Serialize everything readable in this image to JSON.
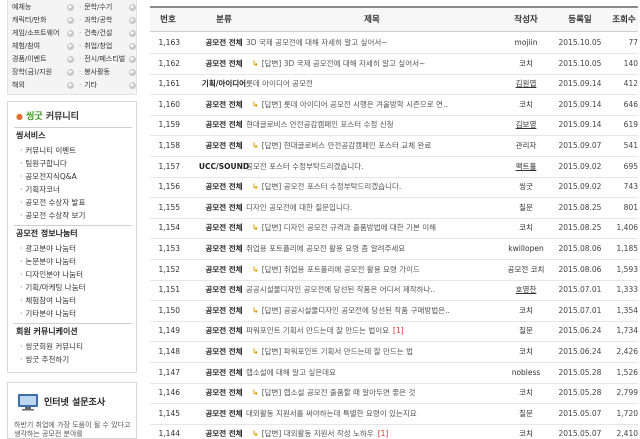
{
  "sidebar": {
    "categories": [
      {
        "left": "예체능",
        "right": "문학/수기"
      },
      {
        "left": "캐릭터/만화",
        "right": "과학/공학"
      },
      {
        "left": "게임/소프트웨어",
        "right": "건축/건설"
      },
      {
        "left": "체험/참여",
        "right": "취업/창업"
      },
      {
        "left": "경품/이벤트",
        "right": "전시/페스티벌"
      },
      {
        "left": "장학(금)/지원",
        "right": "봉사활동"
      },
      {
        "left": "해외",
        "right": "기타"
      }
    ],
    "community": {
      "brand": "씽굿",
      "title": "커뮤니티",
      "sections": [
        {
          "title": "씽서비스",
          "items": [
            "커뮤니티 이벤트",
            "팀원구합니다",
            "공모전지식Q&A",
            "기획자코너",
            "공모전 수상자 발표",
            "공모전 수상작 보기"
          ]
        },
        {
          "title": "공모전 정보나눔터",
          "items": [
            "광고분야 나눔터",
            "논문분야 나눔터",
            "디자인분야 나눔터",
            "기획/마케팅 나눔터",
            "체험참여 나눔터",
            "기타분야 나눔터"
          ]
        },
        {
          "title": "회원 커뮤니케이션",
          "items": [
            "씽굿회원 커뮤니티",
            "씽굿 추천하기"
          ]
        }
      ]
    },
    "survey": {
      "title": "인터넷 설문조사",
      "question": "하반기 취업에 가장 도움이 될 수 있다고 생각하는 공모전 분야를"
    }
  },
  "board": {
    "headers": {
      "num": "번호",
      "category": "분류",
      "title": "제목",
      "author": "작성자",
      "date": "등록일",
      "views": "조회수"
    },
    "reply_tag": "[답변]",
    "rows": [
      {
        "num": "1,163",
        "category": "공모전 전체",
        "reply": false,
        "title": "3D 국제 공모전에 대해 자세히 알고 싶어서~",
        "author": "mojiin",
        "date": "2015.10.05",
        "views": "77"
      },
      {
        "num": "1,162",
        "category": "공모전 전체",
        "reply": true,
        "title": "3D 국제 공모전에 대해 자세히 알고 싶어서~",
        "author": "코치",
        "date": "2015.10.05",
        "views": "140"
      },
      {
        "num": "1,161",
        "category": "기획/아이디어",
        "reply": false,
        "title": "롯데 아이디어 공모전",
        "author": "김원엽",
        "date": "2015.09.14",
        "views": "412",
        "author_link": true
      },
      {
        "num": "1,160",
        "category": "공모전 전체",
        "reply": true,
        "title": "롯데 아이디어 공모전 시행은 겨울방학 시즌으로 연..",
        "author": "코치",
        "date": "2015.09.14",
        "views": "646"
      },
      {
        "num": "1,159",
        "category": "공모전 전체",
        "reply": false,
        "title": "현대글로비스 안전공감캠페인 포스터 수정 신청",
        "author": "김보영",
        "date": "2015.09.14",
        "views": "619",
        "author_link": true
      },
      {
        "num": "1,158",
        "category": "공모전 전체",
        "reply": true,
        "title": "현대글로비스 안전공감캠페인 포스터 교체 완료",
        "author": "관리자",
        "date": "2015.09.07",
        "views": "541"
      },
      {
        "num": "1,157",
        "category": "UCC/SOUND",
        "reply": false,
        "title": "공모전 포스터 수정부탁드리겠습니다.",
        "author": "팩트홀",
        "date": "2015.09.02",
        "views": "695",
        "author_link": true
      },
      {
        "num": "1,156",
        "category": "공모전 전체",
        "reply": true,
        "title": "공모전 포스터 수정부탁드리겠습니다.",
        "author": "씽굿",
        "date": "2015.09.02",
        "views": "743"
      },
      {
        "num": "1,155",
        "category": "공모전 전체",
        "reply": false,
        "title": "디자인 공모전에 대한 질문입니다.",
        "author": "질문",
        "date": "2015.08.25",
        "views": "801"
      },
      {
        "num": "1,154",
        "category": "공모전 전체",
        "reply": true,
        "title": "디자인 공모전 규격과 출품방법에 대한 기본 이해",
        "author": "코치",
        "date": "2015.08.25",
        "views": "1,406"
      },
      {
        "num": "1,153",
        "category": "공모전 전체",
        "reply": false,
        "title": "취업용 포트폴리에 공모전 활용 요령 좀 알려주세요",
        "author": "kwillopen",
        "date": "2015.08.06",
        "views": "1,185"
      },
      {
        "num": "1,152",
        "category": "공모전 전체",
        "reply": true,
        "title": "취업용 포트폴리에 공모전 활용 요령 가이드",
        "author": "공모전 코치",
        "date": "2015.08.06",
        "views": "1,593"
      },
      {
        "num": "1,151",
        "category": "공모전 전체",
        "reply": false,
        "title": "공공시설물디자인 공모전에 당선된 작품은 어디서 제작하나..",
        "author": "호영찬",
        "date": "2015.07.01",
        "views": "1,333",
        "author_link": true
      },
      {
        "num": "1,150",
        "category": "공모전 전체",
        "reply": true,
        "title": "공공시설물디자인 공모전에 당선된 작품 구매방법은..",
        "author": "코치",
        "date": "2015.07.01",
        "views": "1,354"
      },
      {
        "num": "1,149",
        "category": "공모전 전체",
        "reply": false,
        "title": "파워포인트 기획서 만드는데 잘 만드는 법이요",
        "count": "[1]",
        "author": "질문",
        "date": "2015.06.24",
        "views": "1,734"
      },
      {
        "num": "1,148",
        "category": "공모전 전체",
        "reply": true,
        "title": "파워포인트 기획서 만드는데 잘 만드는 법",
        "author": "코치",
        "date": "2015.06.24",
        "views": "2,426"
      },
      {
        "num": "1,147",
        "category": "공모전 전체",
        "reply": false,
        "title": "랩소설에 대해 알고 싶은데요",
        "author": "nobless",
        "date": "2015.05.28",
        "views": "1,526"
      },
      {
        "num": "1,146",
        "category": "공모전 전체",
        "reply": true,
        "title": "랩소설 공모전 출품할 때 알아두면 좋은 것",
        "author": "코치",
        "date": "2015.05.28",
        "views": "2,799"
      },
      {
        "num": "1,145",
        "category": "공모전 전체",
        "reply": false,
        "title": "대외활동 지원서를 써야하는데 특별한 요령이 있는지요",
        "author": "질문",
        "date": "2015.05.07",
        "views": "1,720"
      },
      {
        "num": "1,144",
        "category": "공모전 전체",
        "reply": true,
        "title": "대외활동 지원서 작성 노하우",
        "count": "[1]",
        "author": "코치",
        "date": "2015.05.07",
        "views": "2,410"
      }
    ]
  }
}
